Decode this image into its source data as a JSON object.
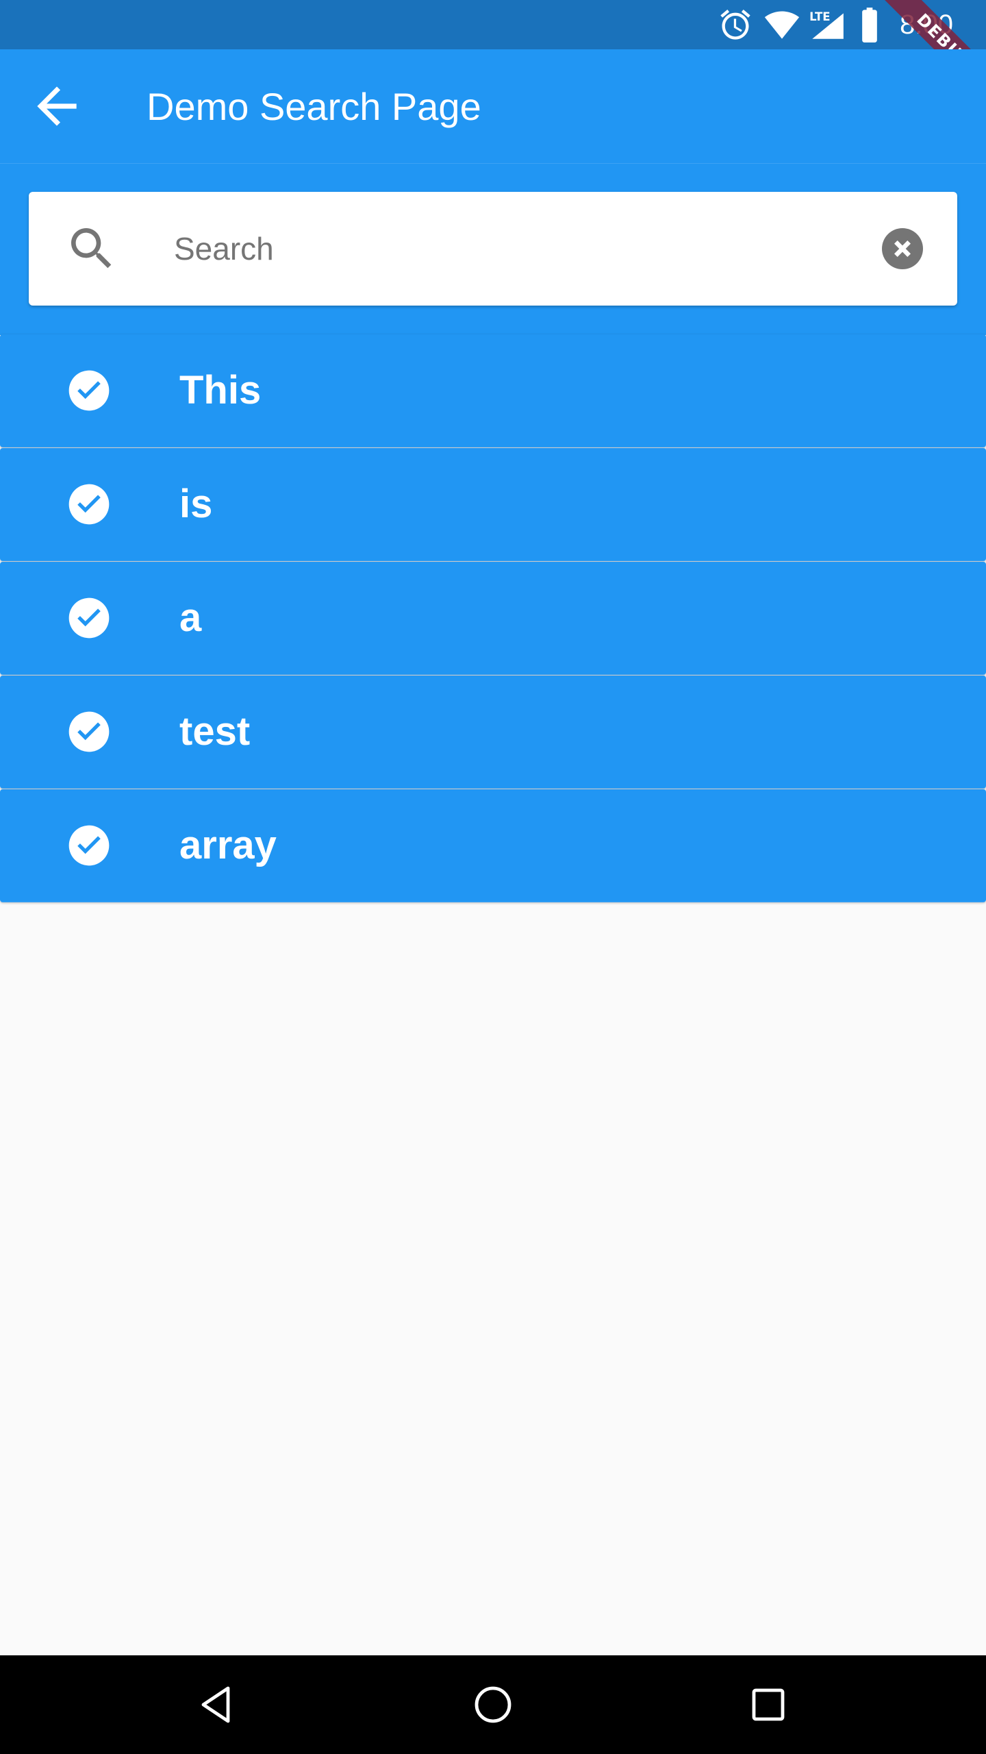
{
  "status_bar": {
    "time": "8:00",
    "icons": [
      "alarm-icon",
      "wifi-icon",
      "lte-signal-icon",
      "battery-icon"
    ],
    "lte_label": "LTE",
    "background": "#1a72bb"
  },
  "debug_banner": {
    "label": "DEBUG",
    "color": "#80223c"
  },
  "app_bar": {
    "title": "Demo Search Page",
    "back_icon": "arrow-back-icon",
    "background": "#2196f3"
  },
  "search": {
    "placeholder": "Search",
    "value": "",
    "icon": "search-icon",
    "clear_icon": "clear-icon"
  },
  "list": {
    "items": [
      {
        "label": "This",
        "icon": "check-circle-icon"
      },
      {
        "label": "is",
        "icon": "check-circle-icon"
      },
      {
        "label": "a",
        "icon": "check-circle-icon"
      },
      {
        "label": "test",
        "icon": "check-circle-icon"
      },
      {
        "label": "array",
        "icon": "check-circle-icon"
      }
    ],
    "item_color": "#2196f3"
  },
  "nav_bar": {
    "buttons": [
      "back-triangle-icon",
      "home-circle-icon",
      "recents-square-icon"
    ]
  }
}
